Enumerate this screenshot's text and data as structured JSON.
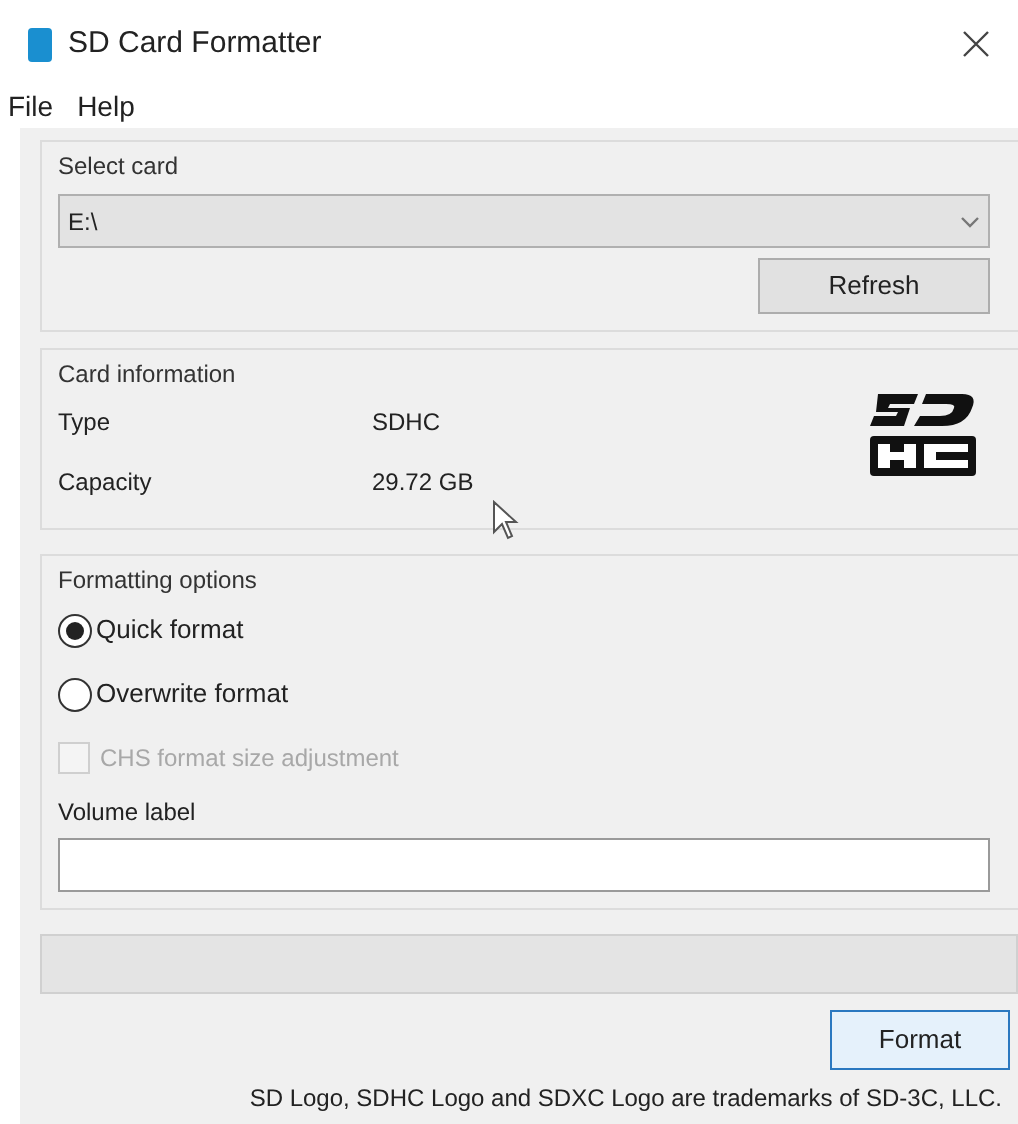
{
  "window": {
    "title": "SD Card Formatter"
  },
  "menu": [
    "File",
    "Help"
  ],
  "select_card": {
    "label": "Select card",
    "drive": "E:\\",
    "refresh": "Refresh"
  },
  "card_info": {
    "label": "Card information",
    "rows": [
      {
        "label": "Type",
        "value": "SDHC"
      },
      {
        "label": "Capacity",
        "value": "29.72 GB"
      }
    ]
  },
  "formatting_options": {
    "label": "Formatting options",
    "options": [
      {
        "kind": "radio",
        "label": "Quick format",
        "selected": true,
        "disabled": false
      },
      {
        "kind": "radio",
        "label": "Overwrite format",
        "selected": false,
        "disabled": false
      },
      {
        "kind": "checkbox",
        "label": "CHS format size adjustment",
        "checked": false,
        "disabled": true
      }
    ],
    "volume_label": "Volume label"
  },
  "progress": {
    "level": 0
  },
  "format_button": "Format",
  "footer": "SD Logo, SDHC Logo and SDXC Logo are trademarks of SD-3C, LLC."
}
